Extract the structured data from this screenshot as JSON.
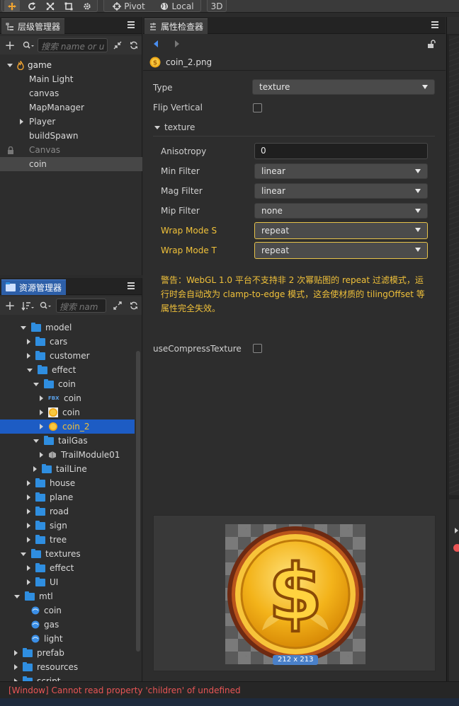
{
  "toolbar": {
    "pivot_label": "Pivot",
    "local_label": "Local",
    "mode3d_label": "3D"
  },
  "hierarchy": {
    "tab_label": "层级管理器",
    "search_placeholder": "搜索 name or u",
    "items": [
      {
        "label": "game",
        "depth": 0,
        "expand": "down",
        "icon": "flame-icon"
      },
      {
        "label": "Main Light",
        "depth": 1,
        "expand": ""
      },
      {
        "label": "canvas",
        "depth": 1,
        "expand": ""
      },
      {
        "label": "MapManager",
        "depth": 1,
        "expand": ""
      },
      {
        "label": "Player",
        "depth": 1,
        "expand": "right"
      },
      {
        "label": "buildSpawn",
        "depth": 1,
        "expand": ""
      },
      {
        "label": "Canvas",
        "depth": 1,
        "expand": "",
        "locked": true
      },
      {
        "label": "coin",
        "depth": 1,
        "expand": "",
        "selected": true
      }
    ]
  },
  "assets": {
    "tab_label": "资源管理器",
    "search_placeholder": "搜索 nam",
    "items": [
      {
        "label": "model",
        "depth": 1,
        "expand": "down",
        "kind": "folder"
      },
      {
        "label": "cars",
        "depth": 2,
        "expand": "right",
        "kind": "folder"
      },
      {
        "label": "customer",
        "depth": 2,
        "expand": "right",
        "kind": "folder"
      },
      {
        "label": "effect",
        "depth": 2,
        "expand": "down",
        "kind": "folder"
      },
      {
        "label": "coin",
        "depth": 3,
        "expand": "down",
        "kind": "folder"
      },
      {
        "label": "coin",
        "depth": 4,
        "expand": "right",
        "kind": "fbx"
      },
      {
        "label": "coin",
        "depth": 4,
        "expand": "right",
        "kind": "image"
      },
      {
        "label": "coin_2",
        "depth": 4,
        "expand": "right",
        "kind": "texture",
        "selected": true
      },
      {
        "label": "tailGas",
        "depth": 3,
        "expand": "down",
        "kind": "folder"
      },
      {
        "label": "TrailModule01",
        "depth": 4,
        "expand": "right",
        "kind": "module"
      },
      {
        "label": "tailLine",
        "depth": 3,
        "expand": "right",
        "kind": "folder"
      },
      {
        "label": "house",
        "depth": 2,
        "expand": "right",
        "kind": "folder"
      },
      {
        "label": "plane",
        "depth": 2,
        "expand": "right",
        "kind": "folder"
      },
      {
        "label": "road",
        "depth": 2,
        "expand": "right",
        "kind": "folder"
      },
      {
        "label": "sign",
        "depth": 2,
        "expand": "right",
        "kind": "folder"
      },
      {
        "label": "tree",
        "depth": 2,
        "expand": "right",
        "kind": "folder"
      },
      {
        "label": "textures",
        "depth": 1,
        "expand": "down",
        "kind": "folder"
      },
      {
        "label": "effect",
        "depth": 2,
        "expand": "right",
        "kind": "folder"
      },
      {
        "label": "UI",
        "depth": 2,
        "expand": "right",
        "kind": "folder"
      },
      {
        "label": "mtl",
        "depth": 0,
        "expand": "down",
        "kind": "folder"
      },
      {
        "label": "coin",
        "depth": 1,
        "expand": "",
        "kind": "material"
      },
      {
        "label": "gas",
        "depth": 1,
        "expand": "",
        "kind": "material"
      },
      {
        "label": "light",
        "depth": 1,
        "expand": "",
        "kind": "material"
      },
      {
        "label": "prefab",
        "depth": 0,
        "expand": "right",
        "kind": "folder"
      },
      {
        "label": "resources",
        "depth": 0,
        "expand": "right",
        "kind": "folder"
      },
      {
        "label": "script",
        "depth": 0,
        "expand": "right",
        "kind": "folder"
      }
    ]
  },
  "inspector": {
    "tab_label": "属性检查器",
    "file_name": "coin_2.png",
    "type_label": "Type",
    "type_value": "texture",
    "flip_label": "Flip Vertical",
    "section_label": "texture",
    "anisotropy_label": "Anisotropy",
    "anisotropy_value": "0",
    "min_filter_label": "Min Filter",
    "min_filter_value": "linear",
    "mag_filter_label": "Mag Filter",
    "mag_filter_value": "linear",
    "mip_filter_label": "Mip Filter",
    "mip_filter_value": "none",
    "wrap_s_label": "Wrap Mode S",
    "wrap_s_value": "repeat",
    "wrap_t_label": "Wrap Mode T",
    "wrap_t_value": "repeat",
    "warning_text": "警告：WebGL 1.0 平台不支持非 2 次幂贴图的 repeat 过滤模式，运行时会自动改为 clamp-to-edge 模式，这会使材质的 tilingOffset 等属性完全失效。",
    "compress_label": "useCompressTexture",
    "preview_size": "212 x 213"
  },
  "status": {
    "message": "[Window] Cannot read property 'children' of undefined"
  },
  "colors": {
    "accent_blue": "#1d5cc4",
    "warning_yellow": "#f0c13a",
    "error_red": "#e85555"
  }
}
